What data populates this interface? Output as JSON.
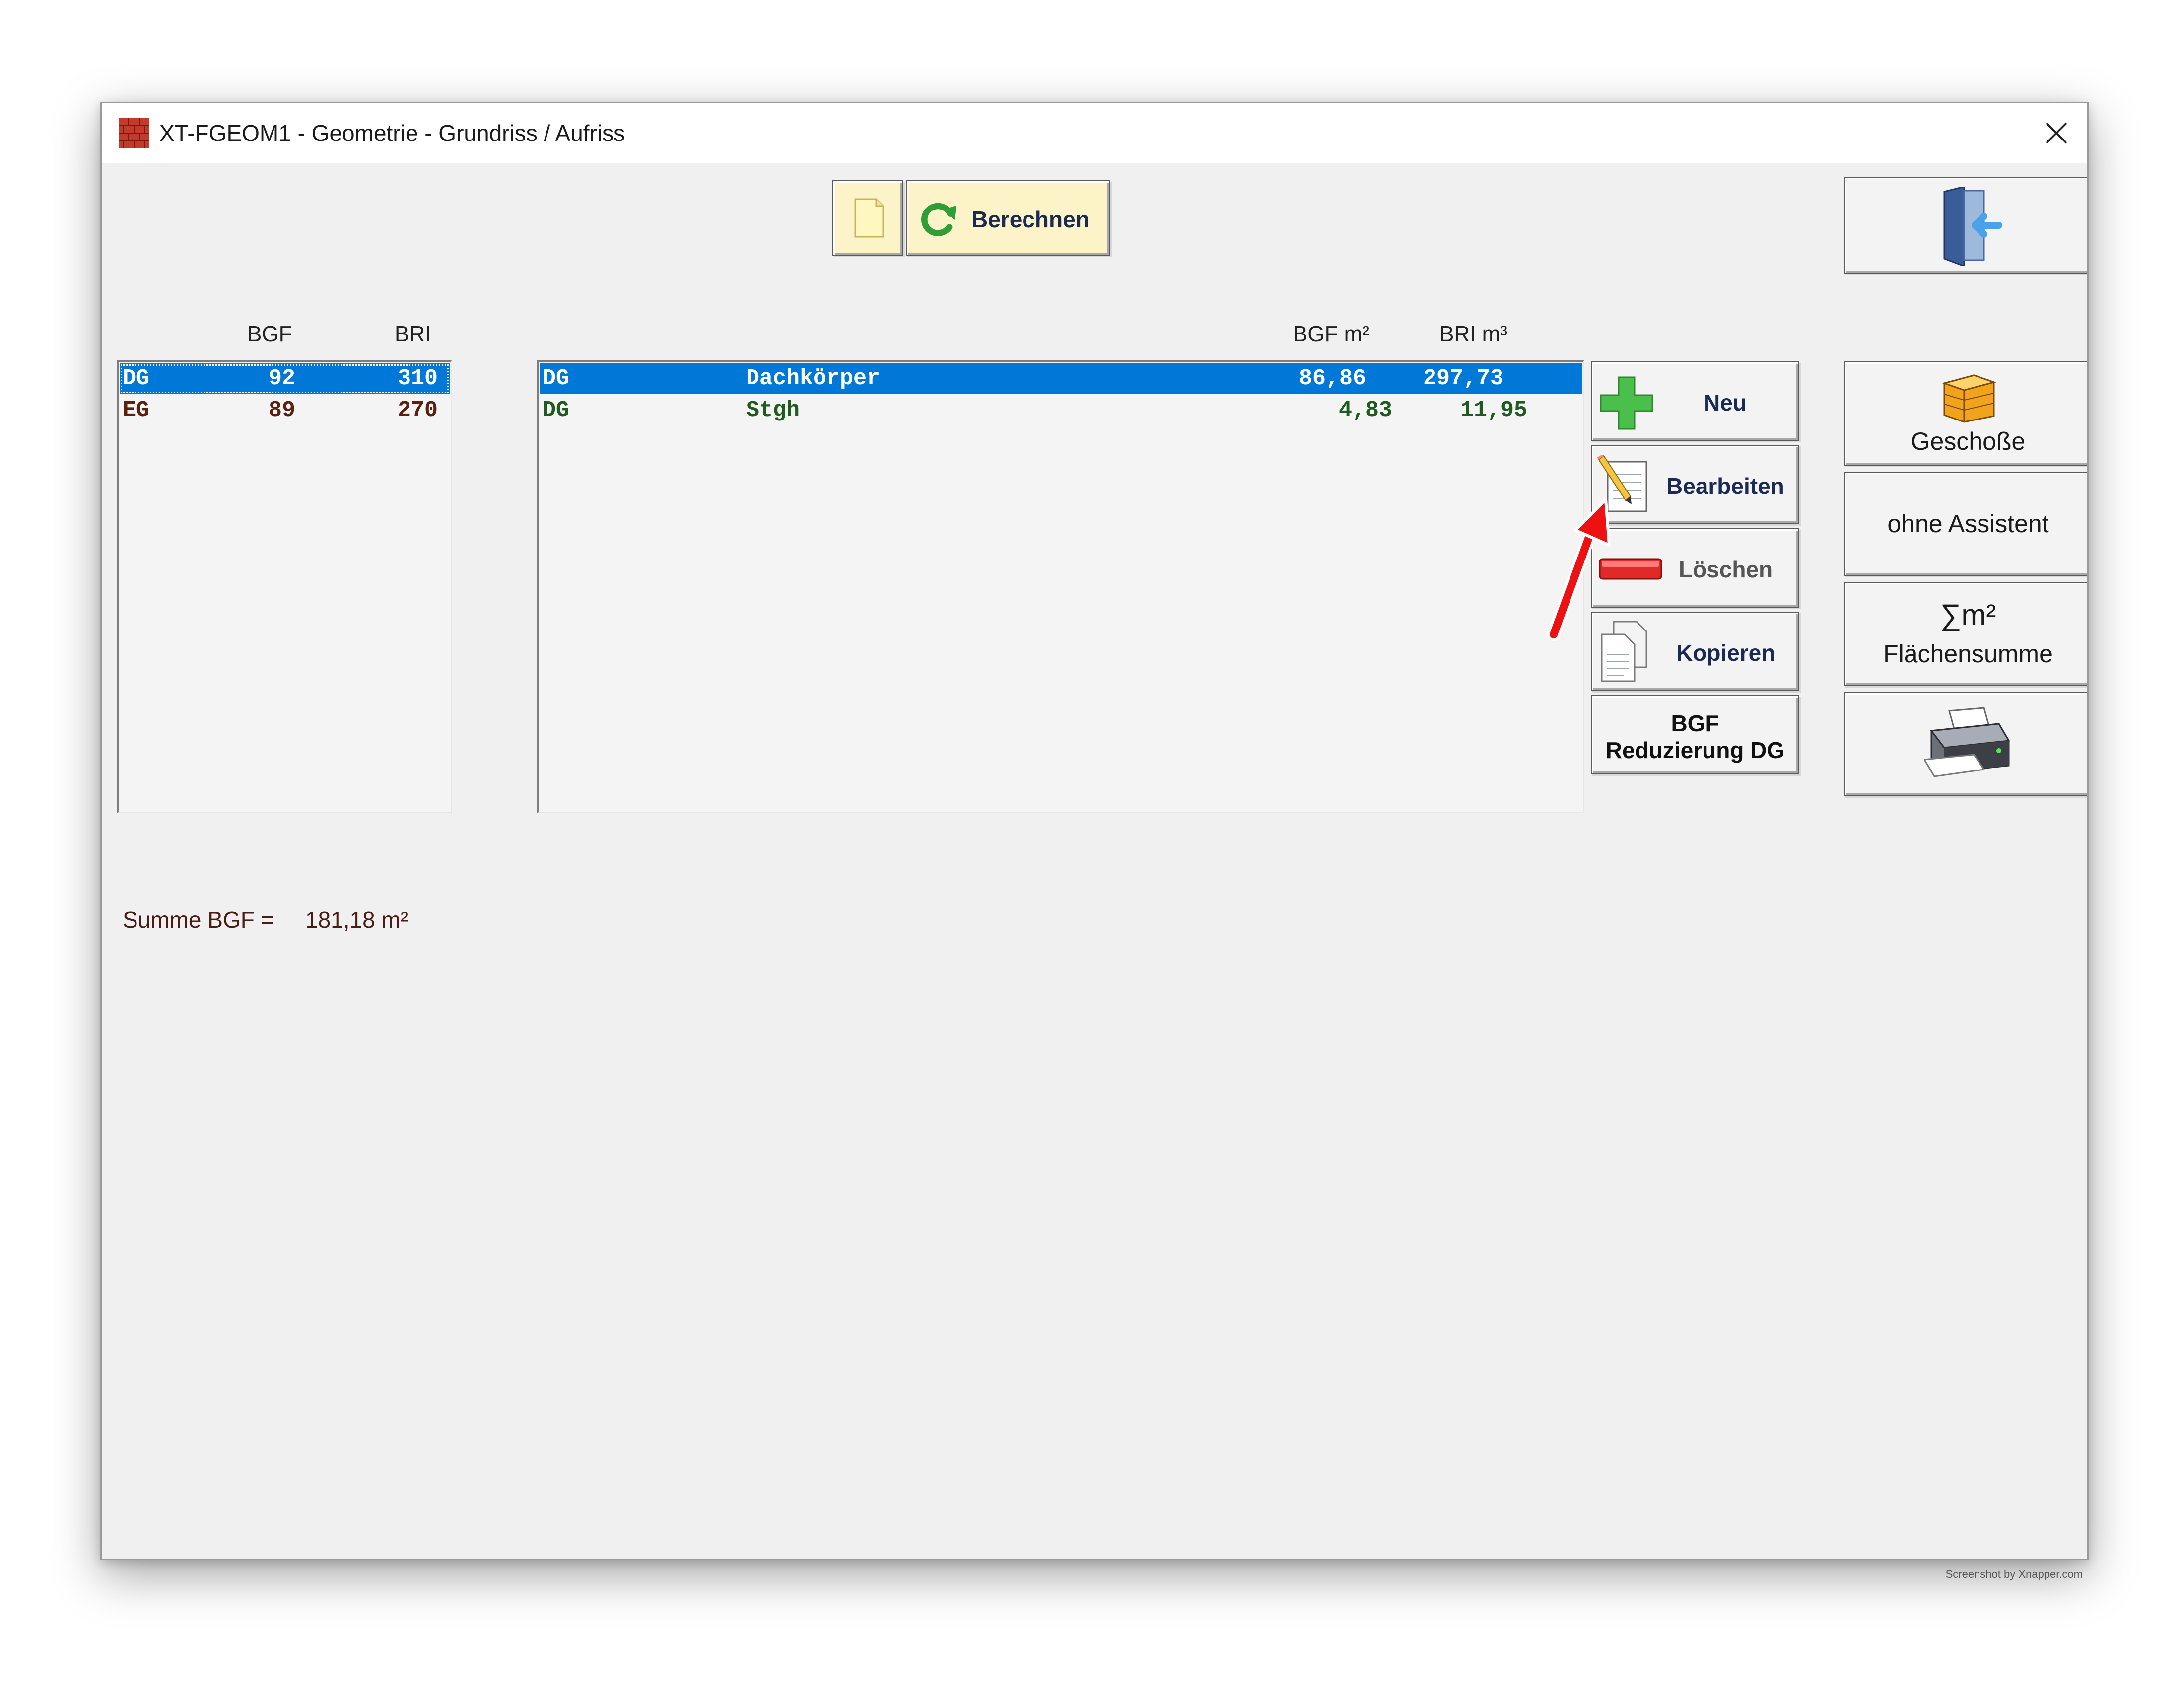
{
  "window": {
    "title": "XT-FGEOM1 - Geometrie - Grundriss / Aufriss",
    "app_icon": "brick-wall-icon",
    "close_icon": "close-icon"
  },
  "toolbar": {
    "new_doc_icon": "document-icon",
    "calculate_label": "Berechnen",
    "calculate_icon": "refresh-icon",
    "exit_icon": "exit-door-icon"
  },
  "floors_list": {
    "headers": [
      "BGF",
      "BRI"
    ],
    "rows": [
      {
        "name": "DG",
        "bgf": "92",
        "bri": "310",
        "selected": true
      },
      {
        "name": "EG",
        "bgf": "89",
        "bri": "270",
        "selected": false
      }
    ],
    "sum_label": "Summe BGF =",
    "sum_value": "181,18 m²"
  },
  "bodies_list": {
    "headers": [
      "BGF m²",
      "BRI m³"
    ],
    "rows": [
      {
        "floor": "DG",
        "name": "Dachkörper",
        "bgf": "86,86",
        "bri": "297,73",
        "selected": true
      },
      {
        "floor": "DG",
        "name": "Stgh",
        "bgf": "4,83",
        "bri": "11,95",
        "selected": false
      }
    ]
  },
  "action_buttons": {
    "new_label": "Neu",
    "new_icon": "plus-icon",
    "edit_label": "Bearbeiten",
    "edit_icon": "pencil-notepad-icon",
    "delete_label": "Löschen",
    "delete_icon": "minus-icon",
    "copy_label": "Kopieren",
    "copy_icon": "copy-icon",
    "reduction_line1": "BGF",
    "reduction_line2": "Reduzierung DG"
  },
  "side_buttons": {
    "floors_label": "Geschoße",
    "floors_icon": "building-icon",
    "no_assistant_label": "ohne Assistent",
    "area_sum_symbol": "∑m²",
    "area_sum_label": "Flächensumme",
    "print_icon": "printer-icon"
  },
  "annotation": {
    "arrow_icon": "red-arrow-icon"
  },
  "watermark": "Screenshot by Xnapper.com"
}
